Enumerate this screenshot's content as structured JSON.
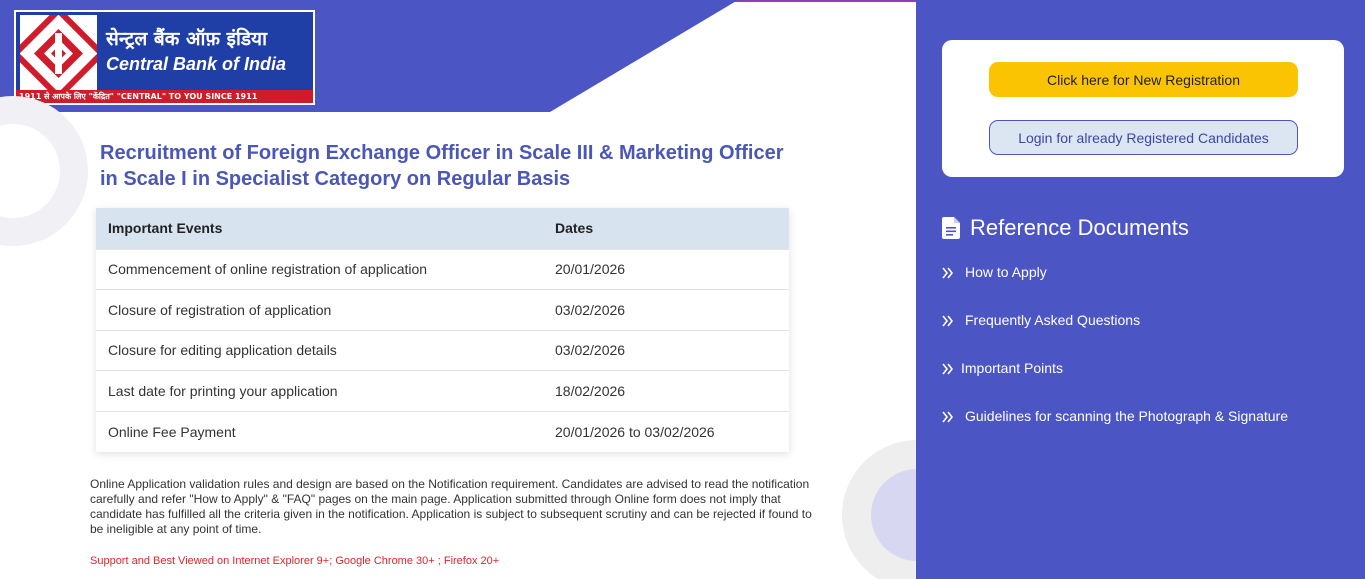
{
  "logo": {
    "hindi_name": "सेन्ट्रल बैंक ऑफ़ इंडिया",
    "english_name": "Central Bank of India",
    "tagline": "1911 से आपके लिए \"केंद्रित\"   \"CENTRAL\" TO YOU SINCE 1911"
  },
  "main": {
    "title": "Recruitment of Foreign Exchange Officer in Scale III & Marketing Officer in Scale I in Specialist Category on Regular Basis",
    "table": {
      "headers": [
        "Important Events",
        "Dates"
      ],
      "rows": [
        [
          "Commencement of online registration of application",
          "20/01/2026"
        ],
        [
          "Closure of registration of application",
          "03/02/2026"
        ],
        [
          "Closure for editing application details",
          "03/02/2026"
        ],
        [
          "Last date for printing your application",
          "18/02/2026"
        ],
        [
          "Online Fee Payment",
          "20/01/2026 to 03/02/2026"
        ]
      ]
    },
    "note": "Online Application validation rules and design are based on the Notification requirement. Candidates are advised to read the notification carefully and refer \"How to Apply\" & \"FAQ\" pages on the main page. Application submitted through Online form does not imply that candidate has fulfilled all the criteria given in the notification. Application is subject to subsequent scrutiny and can be rejected if found to be ineligible at any point of time.",
    "support": "Support and Best Viewed on Internet Explorer 9+; Google Chrome 30+ ; Firefox 20+"
  },
  "sidebar": {
    "new_registration_label": "Click here for New Registration",
    "login_label": "Login for already Registered Candidates",
    "reference_title": "Reference Documents",
    "links": [
      "How to Apply",
      "Frequently Asked Questions",
      "Important Points",
      "Guidelines for scanning the Photograph & Signature"
    ]
  },
  "colors": {
    "brand_blue": "#4b55c4",
    "button_yellow": "#fbc403",
    "logo_red": "#d01c2a",
    "support_red": "#e0242a"
  },
  "icons": [
    "bank-logo-emblem-icon",
    "document-icon",
    "double-chevron-right-icon"
  ]
}
